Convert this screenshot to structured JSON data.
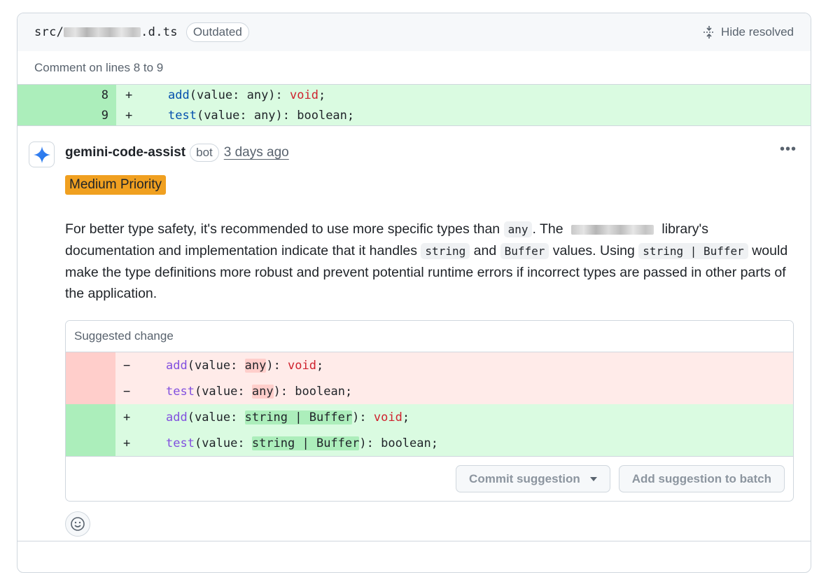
{
  "file": {
    "path_prefix": "src/",
    "path_suffix": ".d.ts",
    "outdated_label": "Outdated",
    "hide_resolved_label": "Hide resolved"
  },
  "comment_lines_label": "Comment on lines 8 to 9",
  "diff": [
    {
      "line": "8",
      "sign": "+",
      "fn": "add",
      "args": "(value: any): ",
      "ret": "void",
      "ret_kind": "kw",
      "end": ";"
    },
    {
      "line": "9",
      "sign": "+",
      "fn": "test",
      "args": "(value: any): ",
      "ret": "boolean",
      "ret_kind": "def",
      "end": ";"
    }
  ],
  "comment": {
    "author": "gemini-code-assist",
    "badge": "bot",
    "time": "3 days ago",
    "priority": "Medium Priority",
    "priority_color": "#f0a020",
    "body": {
      "p1": "For better type safety, it's recommended to use more specific types than ",
      "code1": "any",
      "p2": ". The ",
      "p3": " library's documentation and implementation indicate that it handles ",
      "code2": "string",
      "p4": " and ",
      "code3": "Buffer",
      "p5": " values. Using ",
      "code4": "string | Buffer",
      "p6": " would make the type definitions more robust and prevent potential runtime errors if incorrect types are passed in other parts of the application."
    }
  },
  "suggestion": {
    "header": "Suggested change",
    "removed": [
      {
        "sign": "−",
        "fn": "add",
        "pre": "(value: ",
        "hl": "any",
        "post": "): ",
        "ret": "void",
        "ret_kind": "kw",
        "end": ";"
      },
      {
        "sign": "−",
        "fn": "test",
        "pre": "(value: ",
        "hl": "any",
        "post": "): ",
        "ret": "boolean",
        "ret_kind": "def",
        "end": ";"
      }
    ],
    "added": [
      {
        "sign": "+",
        "fn": "add",
        "pre": "(value: ",
        "hl": "string | Buffer",
        "post": "): ",
        "ret": "void",
        "ret_kind": "kw",
        "end": ";"
      },
      {
        "sign": "+",
        "fn": "test",
        "pre": "(value: ",
        "hl": "string | Buffer",
        "post": "): ",
        "ret": "boolean",
        "ret_kind": "def",
        "end": ";"
      }
    ],
    "commit_label": "Commit suggestion",
    "batch_label": "Add suggestion to batch"
  },
  "icons": {
    "hide_resolved": "unfold-icon",
    "avatar": "gemini-sparkle-icon",
    "more": "kebab-icon",
    "emoji": "smiley-icon",
    "dropdown": "caret-down-icon"
  }
}
